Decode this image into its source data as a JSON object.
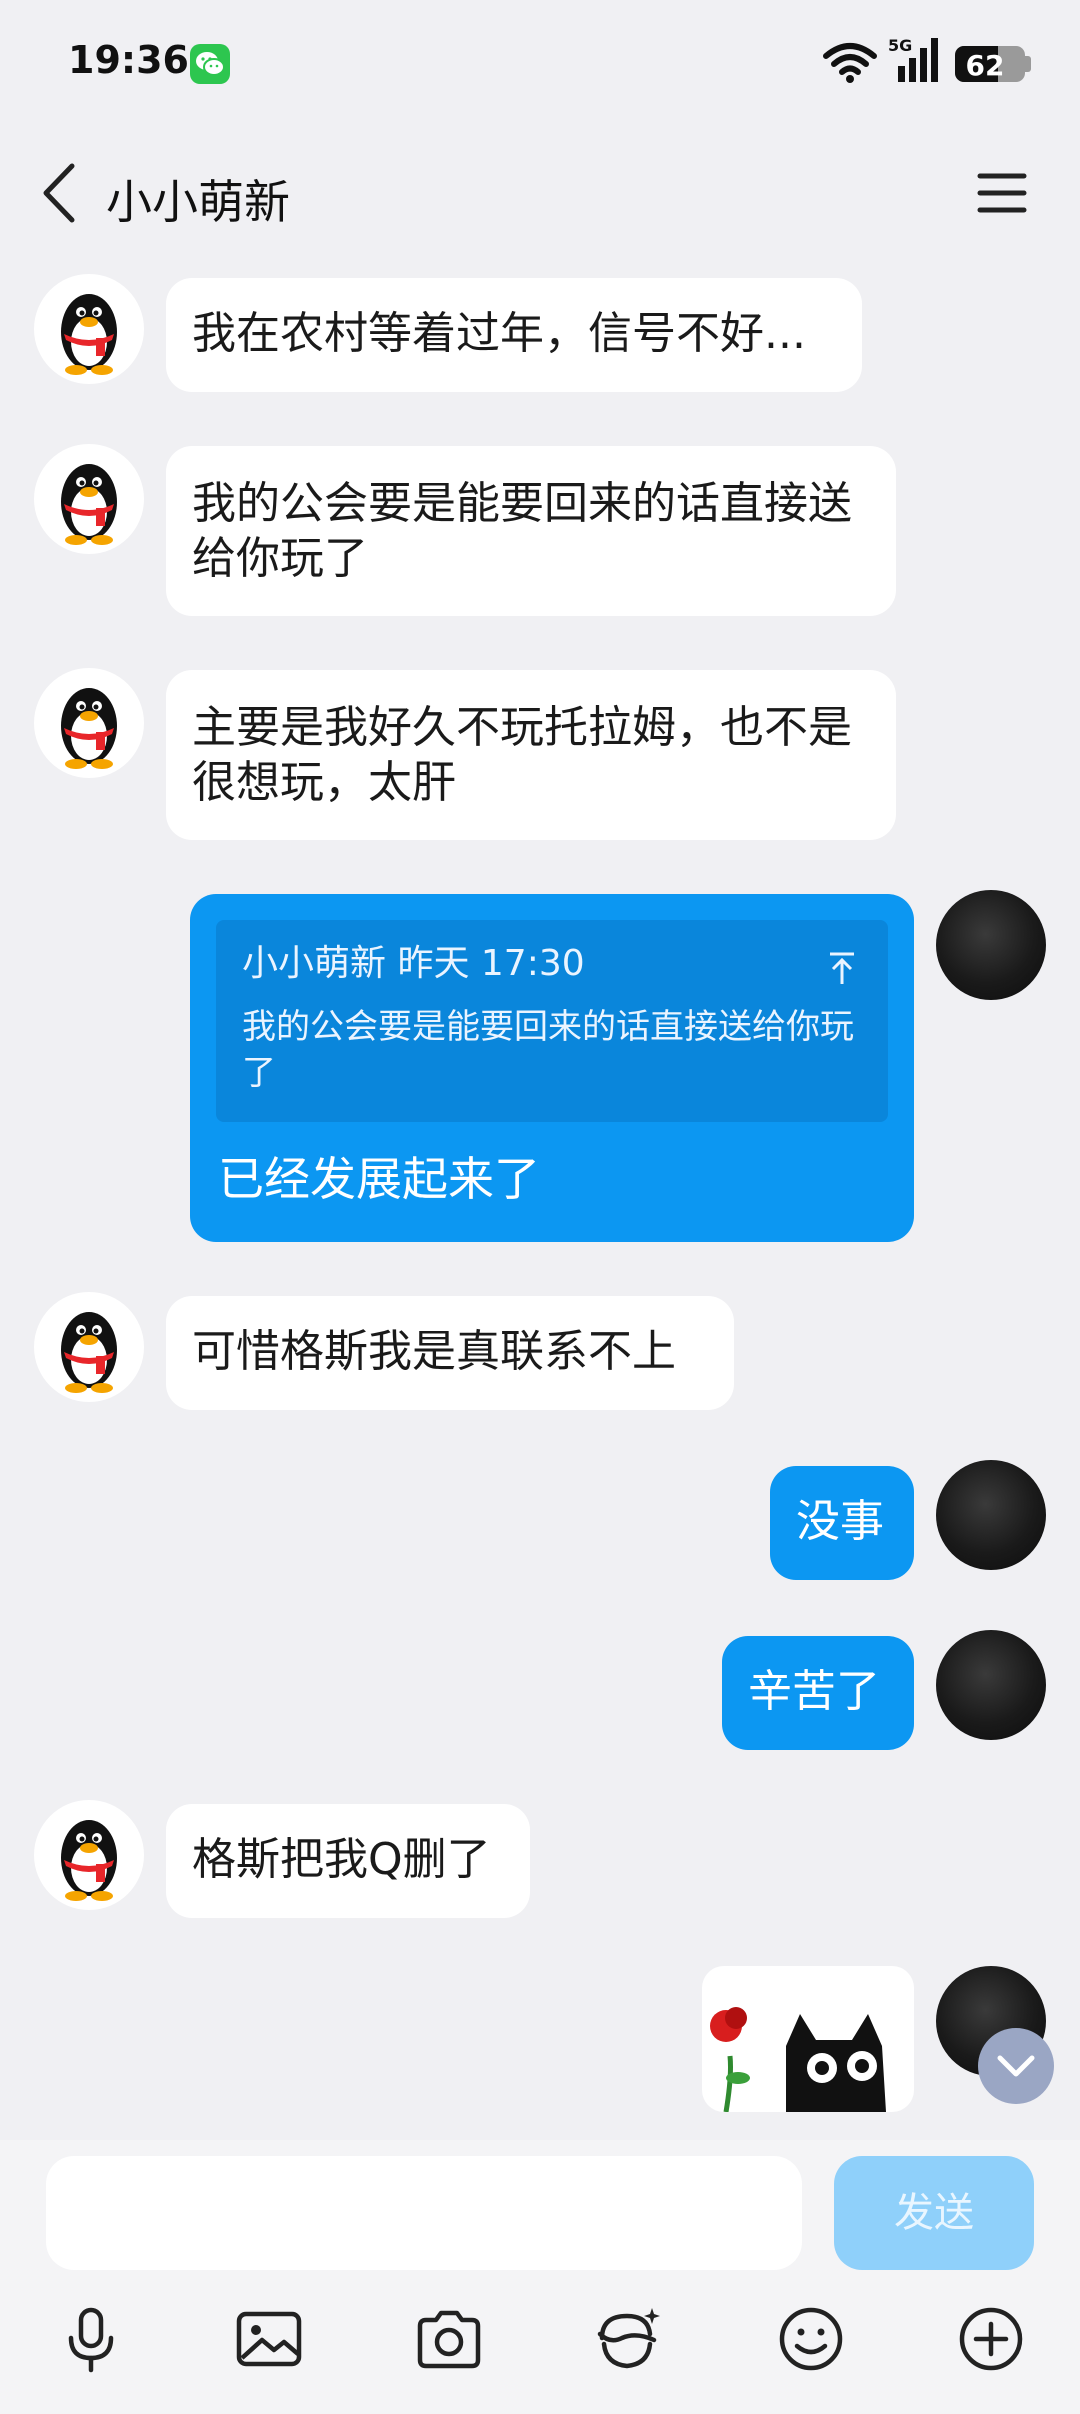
{
  "status_bar": {
    "time": "19:36",
    "network": "5G",
    "battery": "62",
    "battery_level": 0.62
  },
  "header": {
    "title": "小小萌新"
  },
  "messages": [
    {
      "side": "in",
      "text": "我在农村等着过年，信号不好..."
    },
    {
      "side": "in",
      "text": "我的公会要是能要回来的话直接送给你玩了"
    },
    {
      "side": "in",
      "text": "主要是我好久不玩托拉姆，也不是很想玩，太肝"
    },
    {
      "side": "out",
      "quote": {
        "meta": "小小萌新 昨天 17:30",
        "text": "我的公会要是能要回来的话直接送给你玩了"
      },
      "text": "已经发展起来了"
    },
    {
      "side": "in",
      "text": "可惜格斯我是真联系不上"
    },
    {
      "side": "out",
      "text": "没事"
    },
    {
      "side": "out",
      "text": "辛苦了"
    },
    {
      "side": "in",
      "text": "格斯把我Q删了"
    },
    {
      "side": "out",
      "type": "sticker"
    }
  ],
  "input": {
    "value": "",
    "placeholder": "",
    "send_label": "发送"
  },
  "toolbar": [
    "mic-icon",
    "image-icon",
    "camera-icon",
    "red-packet-icon",
    "emoji-icon",
    "plus-icon"
  ],
  "colors": {
    "bubble_out": "#0c97f2",
    "bubble_in": "#ffffff",
    "background": "#f0f0f3",
    "send_disabled": "#8fd0fa"
  }
}
